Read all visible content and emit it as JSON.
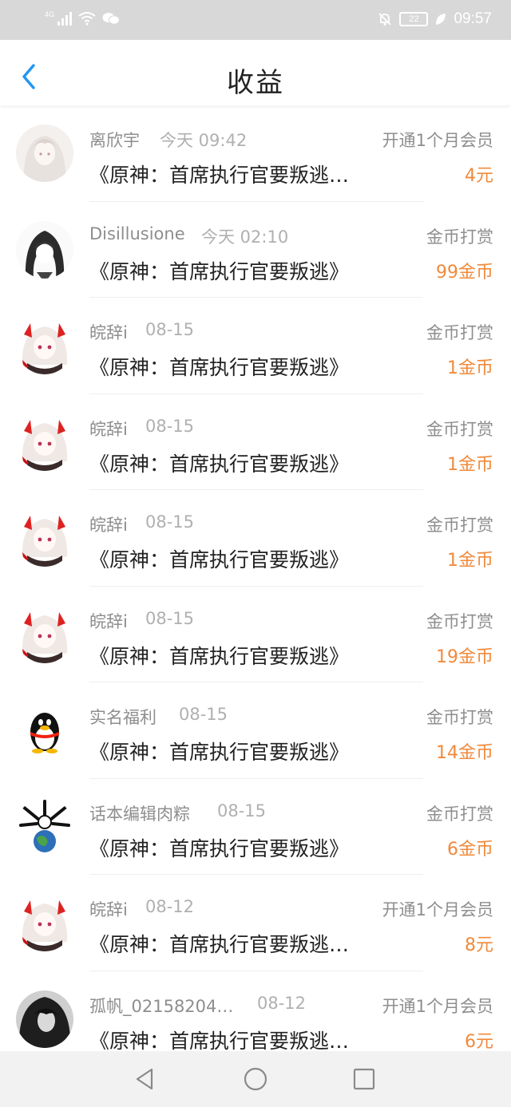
{
  "status_bar": {
    "network_label": "4G",
    "battery": "22",
    "time": "09:57",
    "icons": [
      "signal-icon",
      "wifi-icon",
      "wechat-icon",
      "mute-icon",
      "battery-icon",
      "leaf-icon"
    ]
  },
  "header": {
    "title": "收益",
    "back_icon": "back-chevron-icon"
  },
  "colors": {
    "accent": "#2196f3",
    "amount": "#f08a3c",
    "name": "#8e8e8e",
    "title": "#222222"
  },
  "records": [
    {
      "name": "离欣宇",
      "date": "今天 09:42",
      "type": "开通1个月会员",
      "book": "《原神：首席执行官要叛逃…",
      "amount": "4元",
      "avatar": "anime-white-hair-avatar"
    },
    {
      "name": "Disillusione",
      "date": "今天 02:10",
      "type": "金币打赏",
      "book": "《原神：首席执行官要叛逃》",
      "amount": "99金币",
      "avatar": "anime-sketch-avatar"
    },
    {
      "name": "皖辞i",
      "date": "08-15",
      "type": "金币打赏",
      "book": "《原神：首席执行官要叛逃》",
      "amount": "1金币",
      "avatar": "anime-red-horn-avatar"
    },
    {
      "name": "皖辞i",
      "date": "08-15",
      "type": "金币打赏",
      "book": "《原神：首席执行官要叛逃》",
      "amount": "1金币",
      "avatar": "anime-red-horn-avatar"
    },
    {
      "name": "皖辞i",
      "date": "08-15",
      "type": "金币打赏",
      "book": "《原神：首席执行官要叛逃》",
      "amount": "1金币",
      "avatar": "anime-red-horn-avatar"
    },
    {
      "name": "皖辞i",
      "date": "08-15",
      "type": "金币打赏",
      "book": "《原神：首席执行官要叛逃》",
      "amount": "19金币",
      "avatar": "anime-red-horn-avatar"
    },
    {
      "name": "实名福利",
      "date": "08-15",
      "type": "金币打赏",
      "book": "《原神：首席执行官要叛逃》",
      "amount": "14金币",
      "avatar": "qq-penguin-avatar"
    },
    {
      "name": "话本编辑肉粽",
      "date": "08-15",
      "type": "金币打赏",
      "book": "《原神：首席执行官要叛逃》",
      "amount": "6金币",
      "avatar": "earth-bones-avatar"
    },
    {
      "name": "皖辞i",
      "date": "08-12",
      "type": "开通1个月会员",
      "book": "《原神：首席执行官要叛逃…",
      "amount": "8元",
      "avatar": "anime-red-horn-avatar"
    },
    {
      "name": "孤帆_02158204…",
      "date": "08-12",
      "type": "开通1个月会员",
      "book": "《原神：首席执行官要叛逃…",
      "amount": "6元",
      "avatar": "dark-hair-avatar"
    }
  ],
  "nav_bar": {
    "icons": [
      "back-triangle-icon",
      "home-circle-icon",
      "recents-square-icon"
    ]
  }
}
